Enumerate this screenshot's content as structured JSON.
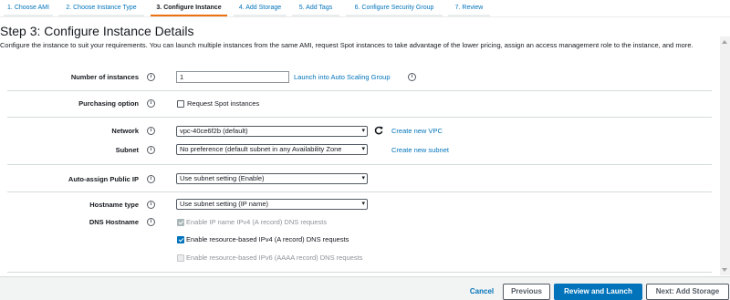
{
  "wizard_steps": [
    {
      "label": "1. Choose AMI"
    },
    {
      "label": "2. Choose Instance Type"
    },
    {
      "label": "3. Configure Instance"
    },
    {
      "label": "4. Add Storage"
    },
    {
      "label": "5. Add Tags"
    },
    {
      "label": "6. Configure Security Group"
    },
    {
      "label": "7. Review"
    }
  ],
  "page": {
    "title": "Step 3: Configure Instance Details",
    "description": "Configure the instance to suit your requirements. You can launch multiple instances from the same AMI, request Spot instances to take advantage of the lower pricing, assign an access management role to the instance, and more."
  },
  "form": {
    "instances": {
      "label": "Number of instances",
      "value": "1",
      "link": "Launch into Auto Scaling Group"
    },
    "purchasing": {
      "label": "Purchasing option",
      "checkbox_label": "Request Spot instances",
      "checked": false
    },
    "network": {
      "label": "Network",
      "value": "vpc-40ce6f2b (default)",
      "link": "Create new VPC",
      "refresh_icon": "refresh-icon"
    },
    "subnet": {
      "label": "Subnet",
      "value": "No preference (default subnet in any Availability Zone",
      "link": "Create new subnet"
    },
    "public_ip": {
      "label": "Auto-assign Public IP",
      "value": "Use subnet setting (Enable)"
    },
    "hostname_type": {
      "label": "Hostname type",
      "value": "Use subnet setting (IP name)"
    },
    "dns_hostname": {
      "label": "DNS Hostname",
      "options": [
        {
          "label": "Enable IP name IPv4 (A record) DNS requests",
          "checked": true,
          "disabled": true
        },
        {
          "label": "Enable resource-based IPv4 (A record) DNS requests",
          "checked": true,
          "disabled": false
        },
        {
          "label": "Enable resource-based IPv6 (AAAA record) DNS requests",
          "checked": false,
          "disabled": true
        }
      ]
    },
    "info_icon": "i"
  },
  "footer": {
    "cancel": "Cancel",
    "previous": "Previous",
    "review_launch": "Review and Launch",
    "next": "Next: Add Storage"
  },
  "colors": {
    "link": "#0073bb",
    "accent": "#ec7211",
    "primary": "#0073bb"
  }
}
